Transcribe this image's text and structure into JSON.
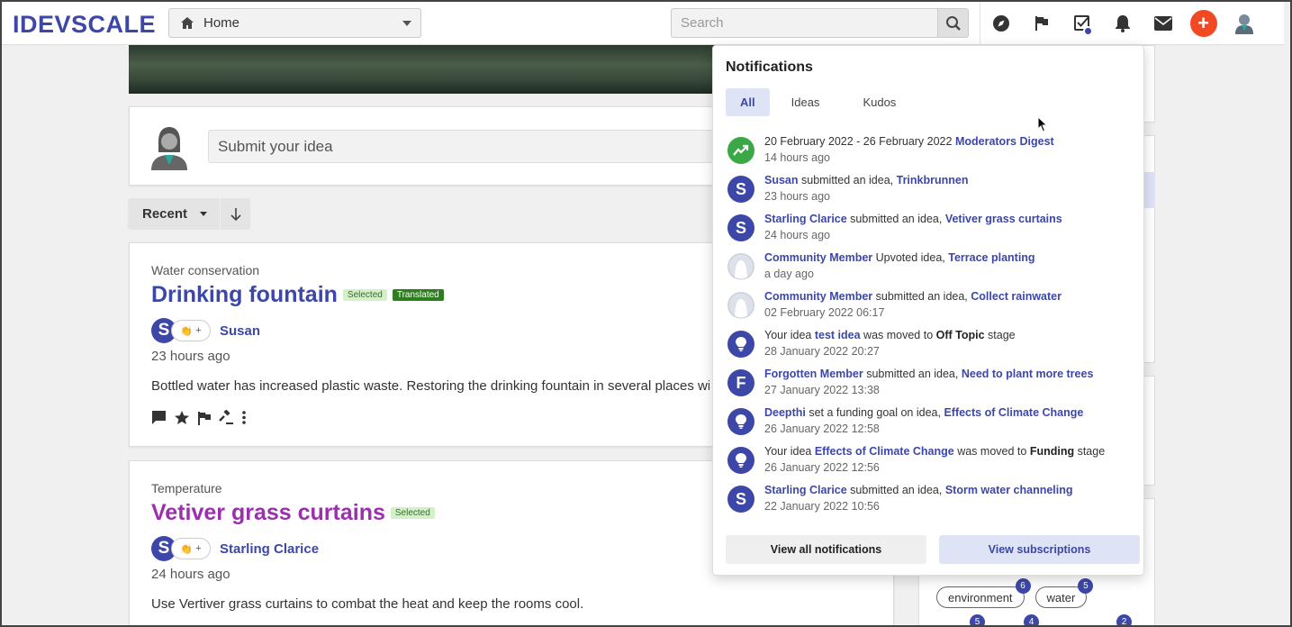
{
  "header": {
    "logo": "IDEVSCALE",
    "nav_select": "Home",
    "search_placeholder": "Search"
  },
  "submit": {
    "placeholder": "Submit your idea"
  },
  "sort": {
    "label": "Recent"
  },
  "ideas": [
    {
      "category": "Water conservation",
      "title": "Drinking fountain",
      "title_color": "#3c47a8",
      "badges": [
        "Selected",
        "Translated"
      ],
      "author": "Susan",
      "author_initial": "S",
      "kudos_plus": "+",
      "time": "23 hours ago",
      "description": "Bottled water has increased plastic waste. Restoring the drinking fountain in several places will"
    },
    {
      "category": "Temperature",
      "title": "Vetiver grass curtains",
      "title_color": "#9b2fae",
      "badges": [
        "Selected"
      ],
      "author": "Starling Clarice",
      "author_initial": "S",
      "kudos_plus": "+",
      "time": "24 hours ago",
      "description": "Use Vertiver grass curtains to combat the heat and keep the rooms cool."
    }
  ],
  "tags": [
    {
      "label": "environment",
      "count": "6"
    },
    {
      "label": "water",
      "count": "5"
    }
  ],
  "tag_row2_counts": [
    "5",
    "4",
    "2"
  ],
  "notifications": {
    "title": "Notifications",
    "tabs": [
      "All",
      "Ideas",
      "Kudos"
    ],
    "items": [
      {
        "icon": "trend",
        "parts": [
          [
            "t",
            "20 February 2022 - 26 February 2022 "
          ],
          [
            "l",
            "Moderators Digest"
          ]
        ],
        "time": "14 hours ago"
      },
      {
        "icon": "S",
        "parts": [
          [
            "l",
            "Susan"
          ],
          [
            "t",
            " submitted an idea, "
          ],
          [
            "l",
            "Trinkbrunnen"
          ]
        ],
        "time": "23 hours ago"
      },
      {
        "icon": "S",
        "parts": [
          [
            "l",
            "Starling Clarice"
          ],
          [
            "t",
            " submitted an idea, "
          ],
          [
            "l",
            "Vetiver grass curtains"
          ]
        ],
        "time": "24 hours ago"
      },
      {
        "icon": "person",
        "parts": [
          [
            "l",
            "Community Member"
          ],
          [
            "t",
            " Upvoted idea, "
          ],
          [
            "l",
            "Terrace planting"
          ]
        ],
        "time": "a day ago"
      },
      {
        "icon": "person",
        "parts": [
          [
            "l",
            "Community Member"
          ],
          [
            "t",
            " submitted an idea, "
          ],
          [
            "l",
            "Collect rainwater"
          ]
        ],
        "time": "02 February 2022 06:17"
      },
      {
        "icon": "bulb",
        "parts": [
          [
            "t",
            "Your idea "
          ],
          [
            "l",
            "test idea"
          ],
          [
            "t",
            " was moved to "
          ],
          [
            "b",
            "Off Topic"
          ],
          [
            "t",
            " stage"
          ]
        ],
        "time": "28 January 2022 20:27"
      },
      {
        "icon": "F",
        "parts": [
          [
            "l",
            "Forgotten Member"
          ],
          [
            "t",
            " submitted an idea, "
          ],
          [
            "l",
            "Need to plant more trees"
          ]
        ],
        "time": "27 January 2022 13:38"
      },
      {
        "icon": "bulb",
        "parts": [
          [
            "l",
            "Deepthi"
          ],
          [
            "t",
            " set a funding goal on idea, "
          ],
          [
            "l",
            "Effects of Climate Change"
          ]
        ],
        "time": "26 January 2022 12:58"
      },
      {
        "icon": "bulb",
        "parts": [
          [
            "t",
            "Your idea "
          ],
          [
            "l",
            "Effects of Climate Change"
          ],
          [
            "t",
            " was moved to "
          ],
          [
            "b",
            "Funding"
          ],
          [
            "t",
            " stage"
          ]
        ],
        "time": "26 January 2022 12:56"
      },
      {
        "icon": "S",
        "parts": [
          [
            "l",
            "Starling Clarice"
          ],
          [
            "t",
            " submitted an idea, "
          ],
          [
            "l",
            "Storm water channeling"
          ]
        ],
        "time": "22 January 2022 10:56"
      }
    ],
    "footer": {
      "view_all": "View all notifications",
      "view_subs": "View subscriptions"
    }
  },
  "colors": {
    "brand": "#3c47a8",
    "accent": "#f04923",
    "green": "#3aa845"
  }
}
